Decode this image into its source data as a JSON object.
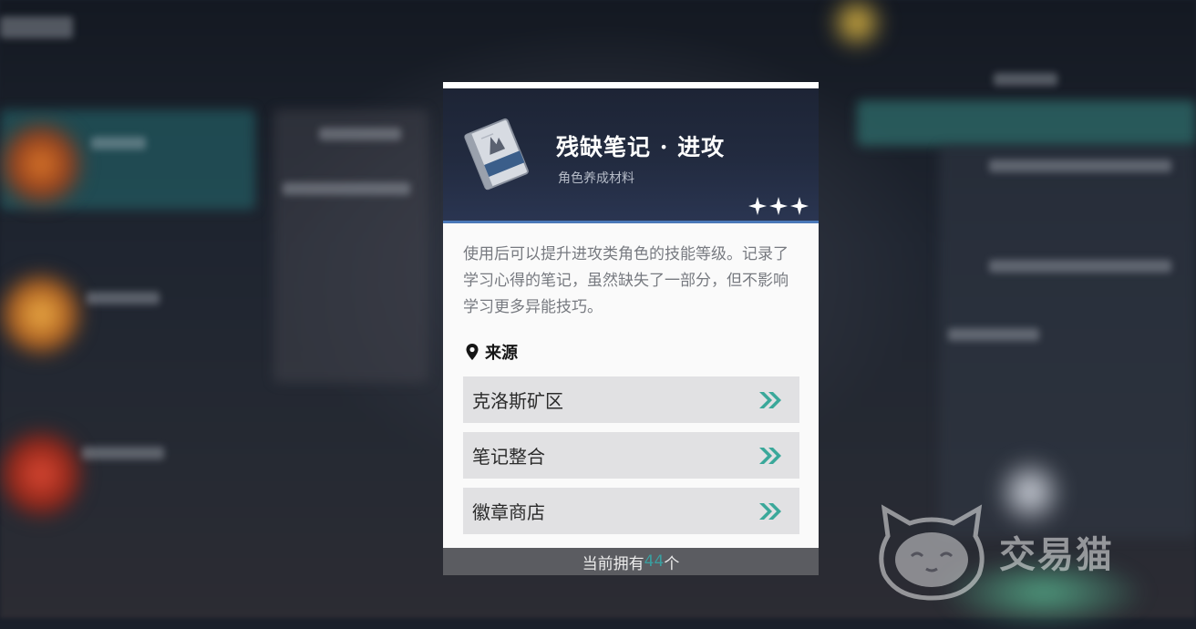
{
  "item": {
    "name": "残缺笔记 · 进攻",
    "category": "角色养成材料",
    "rarity_stars": 3,
    "icon": "note-book-icon",
    "description": "使用后可以提升进攻类角色的技能等级。记录了学习心得的笔记，虽然缺失了一部分，但不影响学习更多异能技巧。"
  },
  "source": {
    "title": "来源",
    "icon": "location-pin-icon",
    "entries": [
      {
        "label": "克洛斯矿区"
      },
      {
        "label": "笔记整合"
      },
      {
        "label": "徽章商店"
      }
    ]
  },
  "footer": {
    "prefix": "当前拥有",
    "count": "44",
    "suffix": "个"
  },
  "watermark": {
    "text": "交易猫"
  },
  "colors": {
    "accent_teal": "#3a9fa0",
    "chevron": "#3aa89a",
    "header_bg": "#1d2435",
    "header_border": "#4a78b8"
  }
}
